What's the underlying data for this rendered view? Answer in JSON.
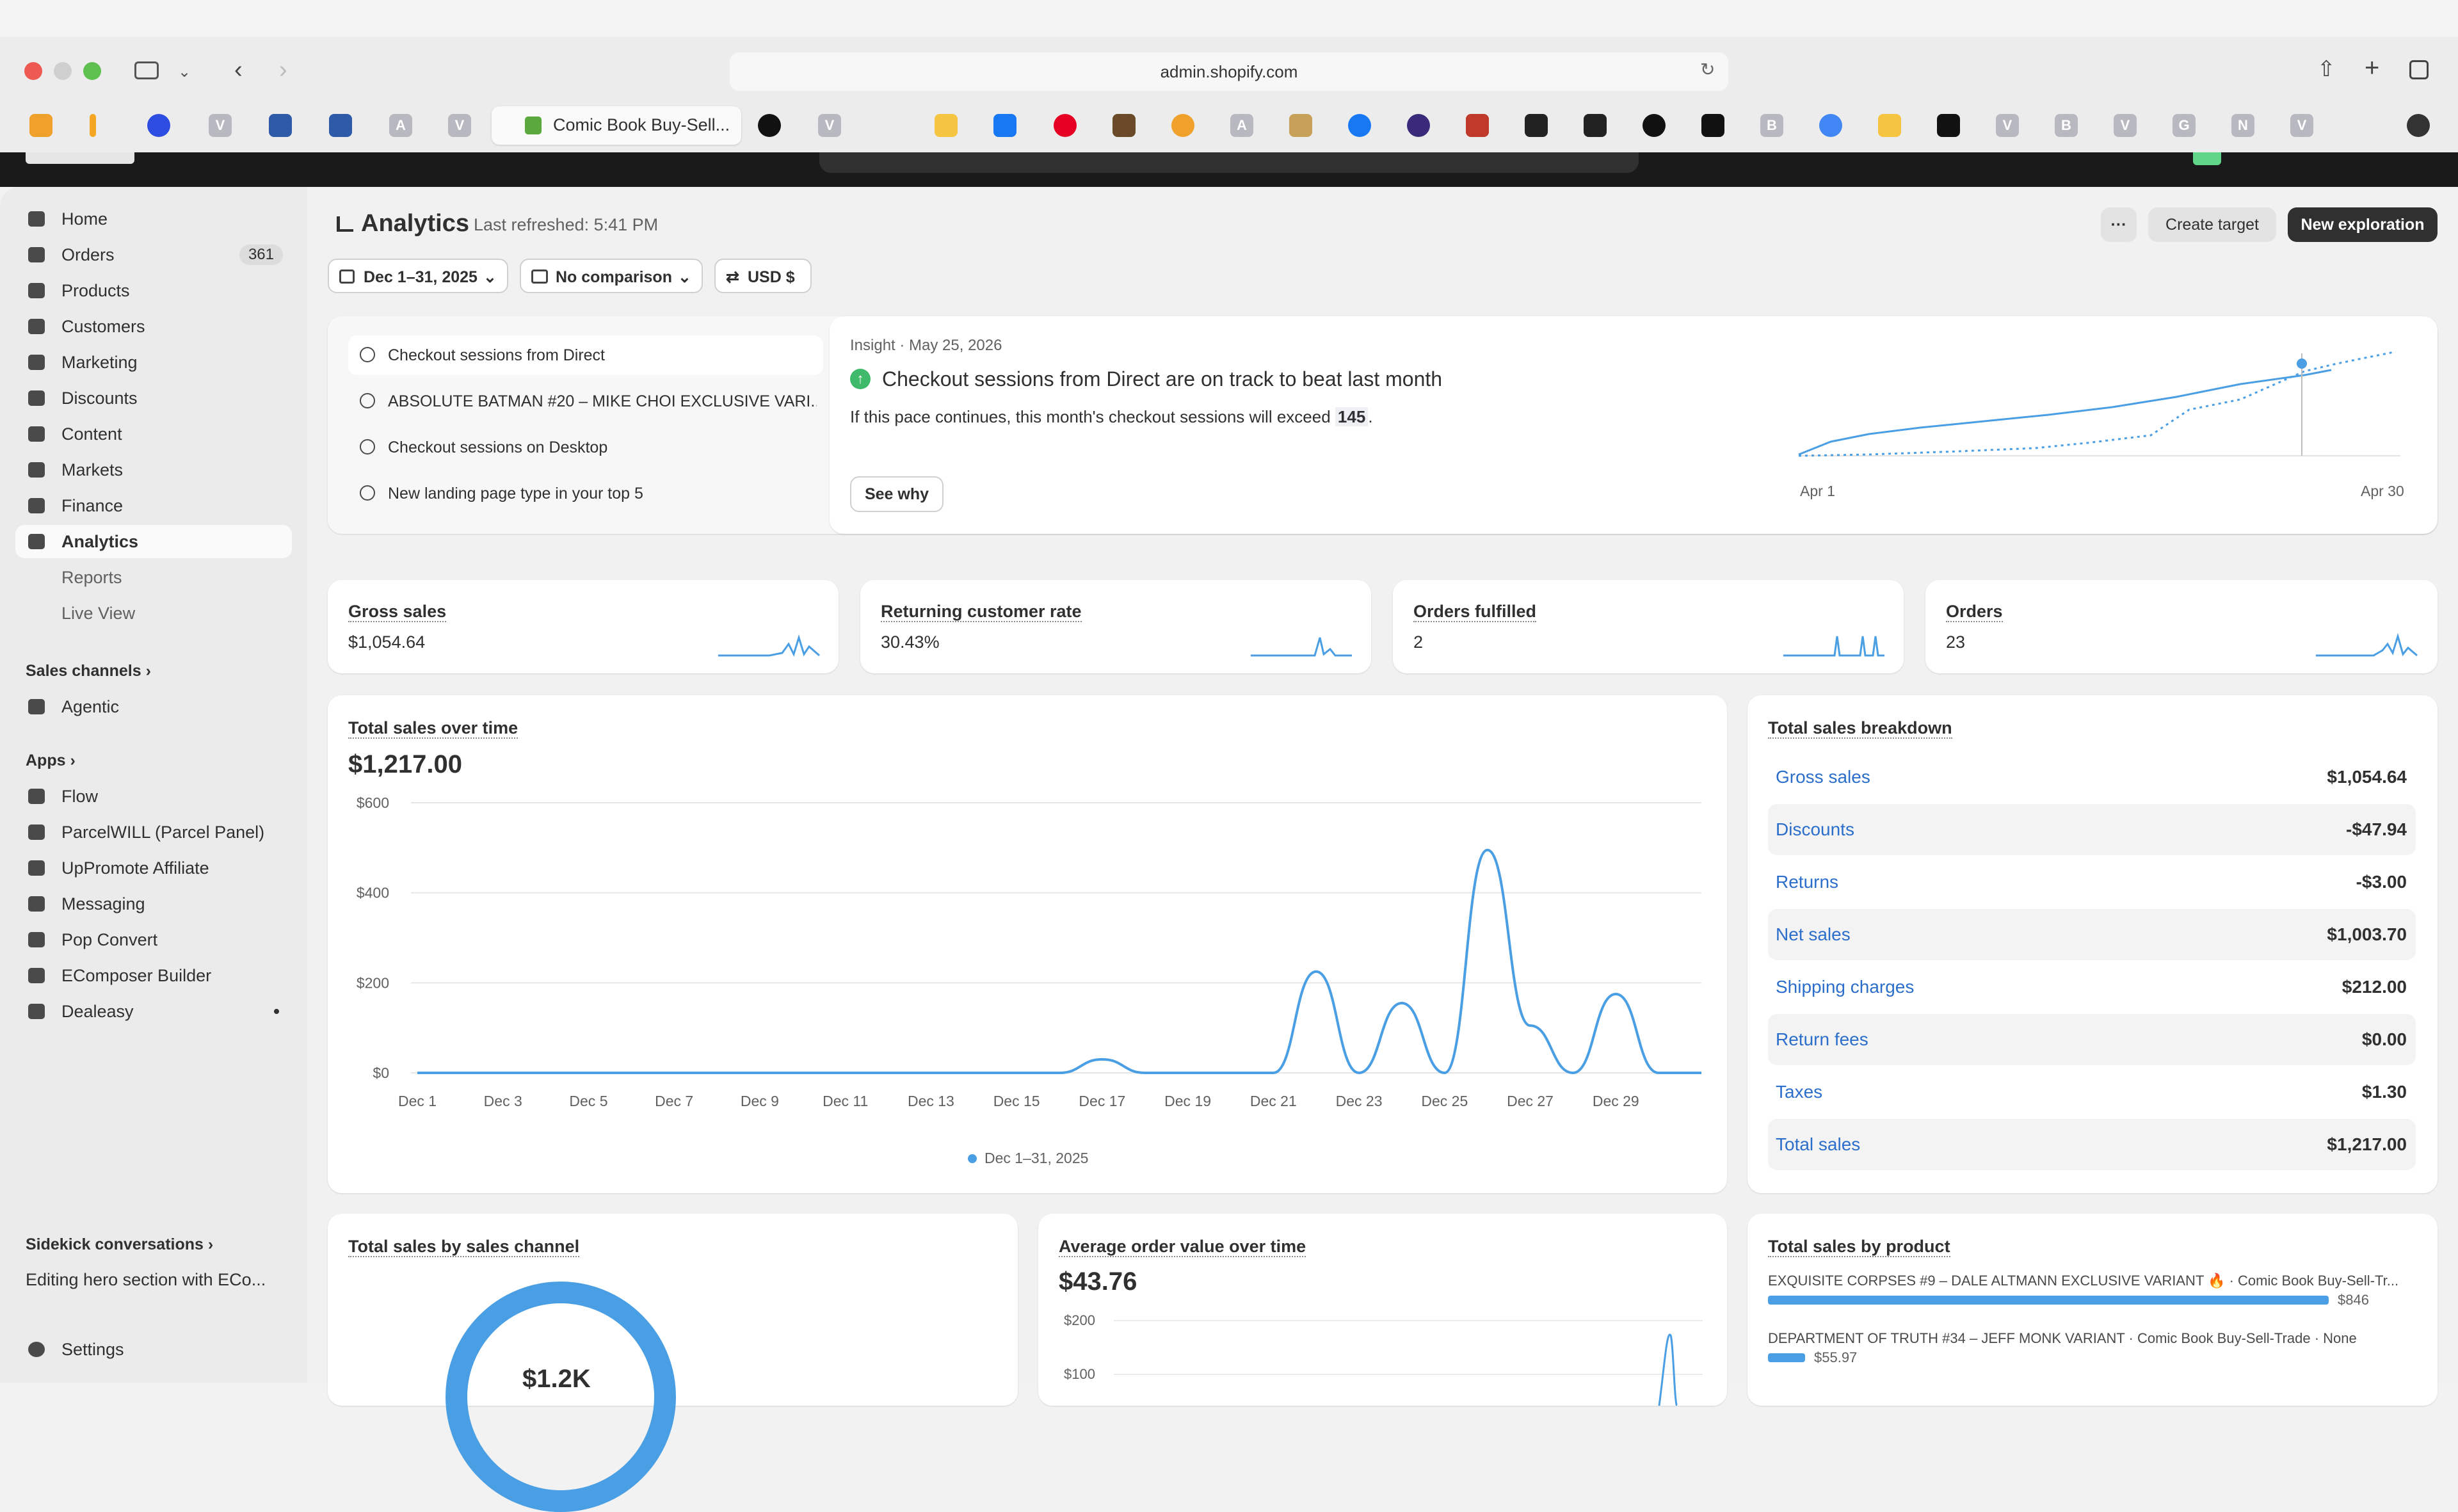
{
  "browser": {
    "url": "admin.shopify.com",
    "active_tab_title": "Comic Book Buy-Sell...",
    "tab_letters": [
      "V",
      "A",
      "V",
      "V",
      "A",
      "B",
      "V",
      "B",
      "V",
      "G",
      "N",
      "V"
    ]
  },
  "sidebar": {
    "items": [
      {
        "label": "Home",
        "icon": "home-icon"
      },
      {
        "label": "Orders",
        "icon": "orders-icon",
        "badge": "361"
      },
      {
        "label": "Products",
        "icon": "tag-icon"
      },
      {
        "label": "Customers",
        "icon": "person-icon"
      },
      {
        "label": "Marketing",
        "icon": "target-icon"
      },
      {
        "label": "Discounts",
        "icon": "discount-icon"
      },
      {
        "label": "Content",
        "icon": "content-icon"
      },
      {
        "label": "Markets",
        "icon": "globe-icon"
      },
      {
        "label": "Finance",
        "icon": "bank-icon"
      },
      {
        "label": "Analytics",
        "icon": "chart-icon"
      }
    ],
    "analytics_sub": [
      "Reports",
      "Live View"
    ],
    "sales_channels_label": "Sales channels",
    "channels": [
      "Agentic"
    ],
    "apps_label": "Apps",
    "apps": [
      "Flow",
      "ParcelWILL (Parcel Panel)",
      "UpPromote Affiliate",
      "Messaging",
      "Pop Convert",
      "EComposer Builder",
      "Dealeasy"
    ],
    "sidekick_label": "Sidekick conversations",
    "sidekick_item": "Editing hero section with ECo...",
    "settings": "Settings"
  },
  "header": {
    "title": "Analytics",
    "refreshed": "Last refreshed: 5:41 PM",
    "more_label": "···",
    "create_target": "Create target",
    "new_exploration": "New exploration",
    "date_filter": "Dec 1–31, 2025",
    "comparison": "No comparison",
    "currency": "USD $"
  },
  "insights": {
    "items": [
      "Checkout sessions from Direct",
      "ABSOLUTE BATMAN #20 – MIKE CHOI EXCLUSIVE VARI...",
      "Checkout sessions on Desktop",
      "New landing page type in your top 5"
    ],
    "meta": "Insight · May 25, 2026",
    "headline": "Checkout sessions from Direct are on track to beat last month",
    "body": "If this pace continues, this month's checkout sessions will exceed",
    "body_value": "145",
    "body_end": ".",
    "see_why": "See why",
    "x_start": "Apr 1",
    "x_end": "Apr 30"
  },
  "metrics": [
    {
      "label": "Gross sales",
      "value": "$1,054.64"
    },
    {
      "label": "Returning customer rate",
      "value": "30.43%"
    },
    {
      "label": "Orders fulfilled",
      "value": "2"
    },
    {
      "label": "Orders",
      "value": "23"
    }
  ],
  "total_sales_card": {
    "title": "Total sales over time",
    "value": "$1,217.00",
    "legend": "Dec 1–31, 2025"
  },
  "chart_data": {
    "type": "line",
    "title": "Total sales over time",
    "x": [
      "Dec 1",
      "Dec 2",
      "Dec 3",
      "Dec 4",
      "Dec 5",
      "Dec 6",
      "Dec 7",
      "Dec 8",
      "Dec 9",
      "Dec 10",
      "Dec 11",
      "Dec 12",
      "Dec 13",
      "Dec 14",
      "Dec 15",
      "Dec 16",
      "Dec 17",
      "Dec 18",
      "Dec 19",
      "Dec 20",
      "Dec 21",
      "Dec 22",
      "Dec 23",
      "Dec 24",
      "Dec 25",
      "Dec 26",
      "Dec 27",
      "Dec 28",
      "Dec 29",
      "Dec 30",
      "Dec 31"
    ],
    "tick_labels": [
      "Dec 1",
      "Dec 3",
      "Dec 5",
      "Dec 7",
      "Dec 9",
      "Dec 11",
      "Dec 13",
      "Dec 15",
      "Dec 17",
      "Dec 19",
      "Dec 21",
      "Dec 23",
      "Dec 25",
      "Dec 27",
      "Dec 29"
    ],
    "series": [
      {
        "name": "Dec 1–31, 2025",
        "values": [
          0,
          0,
          0,
          0,
          0,
          0,
          0,
          0,
          0,
          0,
          0,
          0,
          0,
          0,
          0,
          0,
          30,
          0,
          0,
          0,
          0,
          225,
          0,
          155,
          0,
          495,
          105,
          0,
          175,
          0,
          0
        ]
      }
    ],
    "y_ticks": [
      "$0",
      "$200",
      "$400",
      "$600"
    ],
    "ylim": [
      0,
      600
    ],
    "grid": true,
    "legend": "bottom",
    "color": "#4a9fe4"
  },
  "breakdown": {
    "title": "Total sales breakdown",
    "rows": [
      {
        "label": "Gross sales",
        "value": "$1,054.64"
      },
      {
        "label": "Discounts",
        "value": "-$47.94"
      },
      {
        "label": "Returns",
        "value": "-$3.00"
      },
      {
        "label": "Net sales",
        "value": "$1,003.70"
      },
      {
        "label": "Shipping charges",
        "value": "$212.00"
      },
      {
        "label": "Return fees",
        "value": "$0.00"
      },
      {
        "label": "Taxes",
        "value": "$1.30"
      },
      {
        "label": "Total sales",
        "value": "$1,217.00"
      }
    ]
  },
  "bottom": {
    "by_channel_title": "Total sales by sales channel",
    "donut_value": "$1.2K",
    "aov_title": "Average order value over time",
    "aov_value": "$43.76",
    "aov_ticks": [
      "$200",
      "$100"
    ],
    "by_product_title": "Total sales by product",
    "products": [
      {
        "name": "EXQUISITE CORPSES #9 – DALE ALTMANN EXCLUSIVE VARIANT 🔥 · Comic Book Buy-Sell-Tr...",
        "value": "$846",
        "share": 1.0
      },
      {
        "name": "DEPARTMENT OF TRUTH #34 – JEFF MONK VARIANT · Comic Book Buy-Sell-Trade · None",
        "value": "$55.97",
        "share": 0.066
      }
    ]
  }
}
